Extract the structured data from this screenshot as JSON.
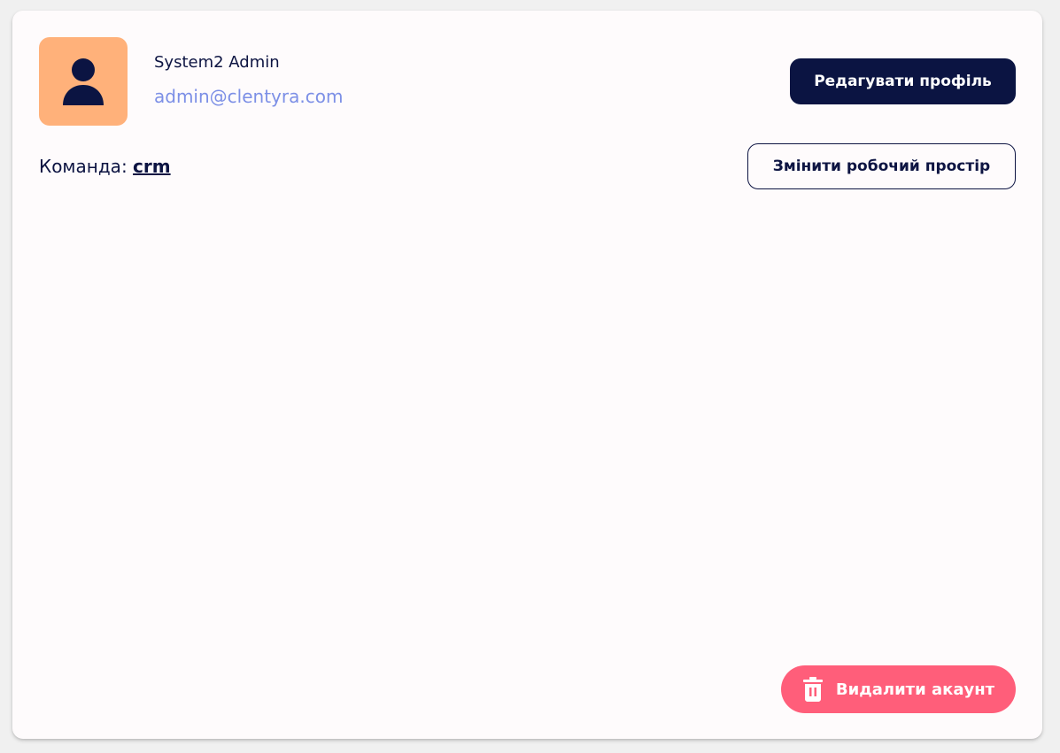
{
  "profile": {
    "avatar_icon": "user-icon",
    "name": "System2 Admin",
    "email": "admin@clentyra.com",
    "edit_button_label": "Редагувати профіль"
  },
  "team": {
    "label": "Команда:",
    "name": "crm",
    "switch_workspace_label": "Змінити робочий простір"
  },
  "danger": {
    "delete_account_label": "Видалити акаунт",
    "icon": "trash-icon"
  },
  "colors": {
    "page_bg": "#f0f0f0",
    "card_bg": "#fefbfc",
    "avatar_bg": "#ffb17a",
    "primary": "#0b1442",
    "email": "#7c8fe6",
    "danger": "#ff5e7a"
  }
}
